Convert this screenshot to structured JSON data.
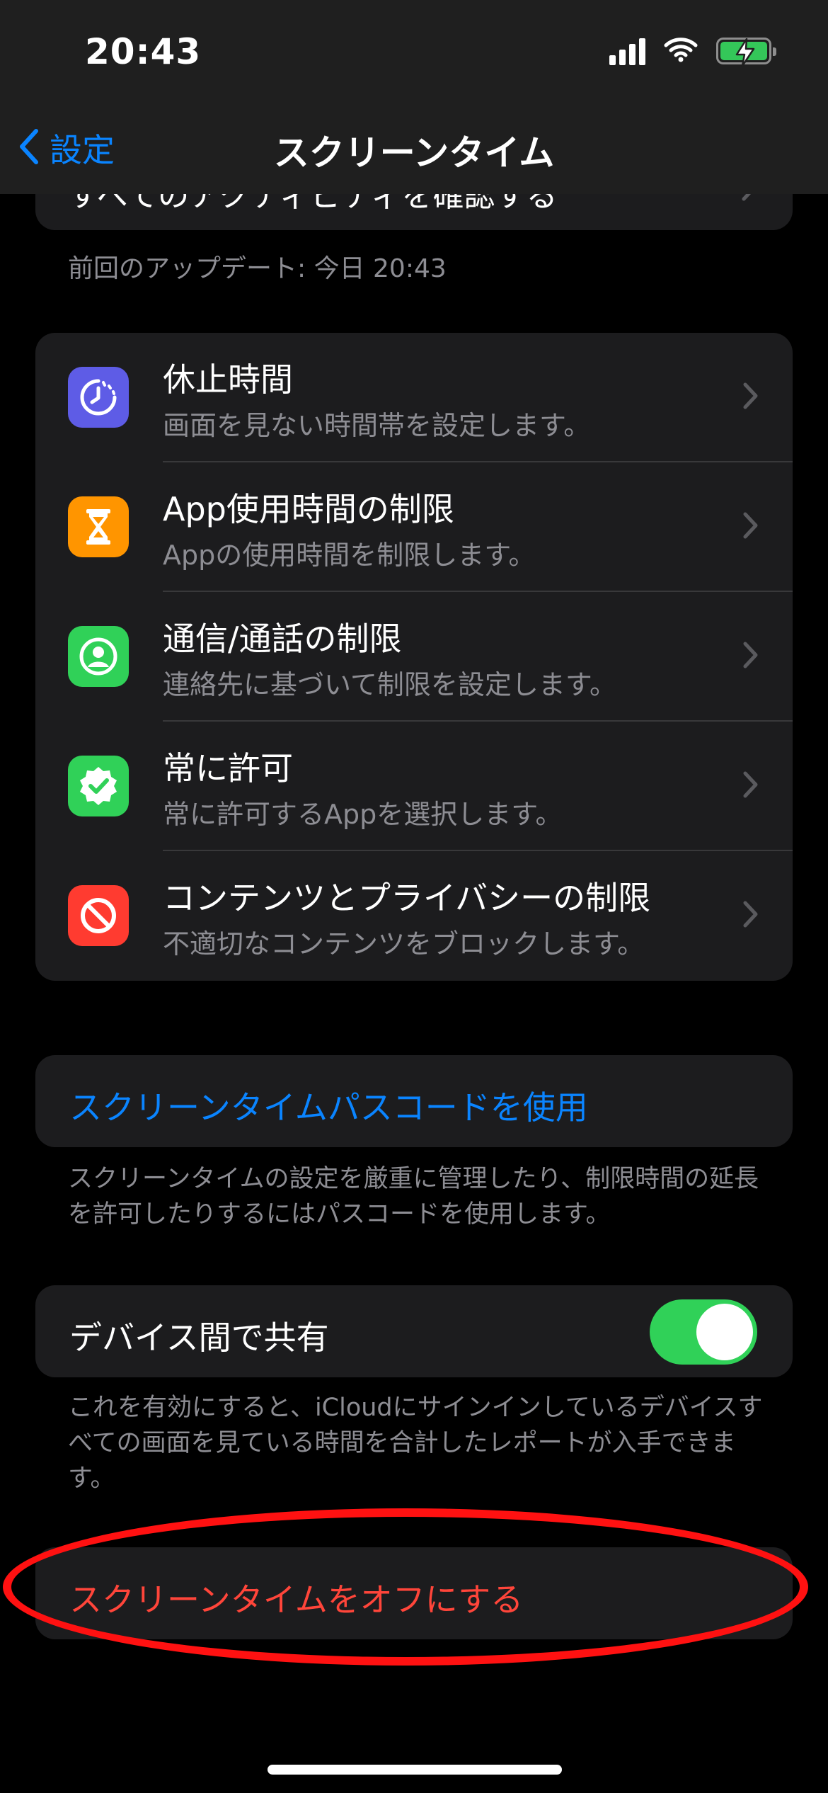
{
  "status_bar": {
    "time": "20:43"
  },
  "nav": {
    "back_label": "設定",
    "title": "スクリーンタイム"
  },
  "peek_card_text": "すべてのアクティビティを確認する",
  "last_updated": "前回のアップデート: 今日 20:43",
  "rows": [
    {
      "title": "休止時間",
      "subtitle": "画面を見ない時間帯を設定します。",
      "icon": "downtime-icon",
      "color": "#5e5ce6"
    },
    {
      "title": "App使用時間の制限",
      "subtitle": "Appの使用時間を制限します。",
      "icon": "hourglass-icon",
      "color": "#ff9500"
    },
    {
      "title": "通信/通話の制限",
      "subtitle": "連絡先に基づいて制限を設定します。",
      "icon": "person-icon",
      "color": "#30d158"
    },
    {
      "title": "常に許可",
      "subtitle": "常に許可するAppを選択します。",
      "icon": "checkmark-badge-icon",
      "color": "#30d158"
    },
    {
      "title": "コンテンツとプライバシーの制限",
      "subtitle": "不適切なコンテンツをブロックします。",
      "icon": "no-entry-icon",
      "color": "#ff3b30"
    }
  ],
  "passcode": {
    "button": "スクリーンタイムパスコードを使用",
    "footnote": "スクリーンタイムの設定を厳重に管理したり、制限時間の延長を許可したりするにはパスコードを使用します。"
  },
  "share": {
    "label": "デバイス間で共有",
    "enabled": true,
    "footnote": "これを有効にすると、iCloudにサインインしているデバイスすべての画面を見ている時間を合計したレポートが入手できます。"
  },
  "turn_off": {
    "label": "スクリーンタイムをオフにする"
  },
  "colors": {
    "accent": "#0a84ff",
    "destructive": "#ff453a",
    "annotation": "#ff1111",
    "toggle_on": "#30d158"
  }
}
